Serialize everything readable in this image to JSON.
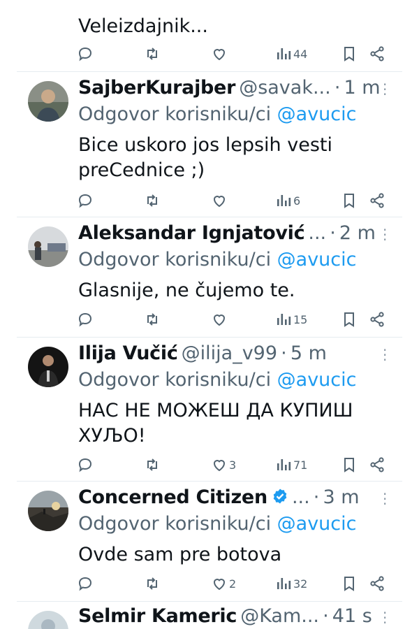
{
  "colors": {
    "accent": "#1d9bf0",
    "secondary_text": "#536471",
    "divider": "#e6ecf0"
  },
  "tweets": [
    {
      "name": "",
      "handle": "",
      "time": "",
      "reply_prefix": "",
      "reply_to": "",
      "text_lines": [
        "Veleizdajnik..."
      ],
      "actions": {
        "replies": "",
        "retweets": "",
        "likes": "",
        "views": "44"
      }
    },
    {
      "name": "SajberKurajber",
      "handle": "@savak...",
      "time": "1 m",
      "reply_prefix": "Odgovor korisniku/ci ",
      "reply_to": "@avucic",
      "text_lines": [
        "Bice uskoro jos lepsih vesti",
        "preCednice ;)"
      ],
      "actions": {
        "replies": "",
        "retweets": "",
        "likes": "",
        "views": "6"
      }
    },
    {
      "name": "Aleksandar Ignjatović",
      "handle": "...",
      "time": "2 m",
      "reply_prefix": "Odgovor korisniku/ci ",
      "reply_to": "@avucic",
      "text_lines": [
        "Glasnije, ne čujemo te."
      ],
      "actions": {
        "replies": "",
        "retweets": "",
        "likes": "",
        "views": "15"
      }
    },
    {
      "name": "Ilija Vučić",
      "handle": "@ilija_v99",
      "time": "5 m",
      "reply_prefix": "Odgovor korisniku/ci ",
      "reply_to": "@avucic",
      "text_lines": [
        "НАС НЕ МОЖЕШ ДА КУПИШ",
        "ХУЉО!"
      ],
      "actions": {
        "replies": "",
        "retweets": "",
        "likes": "3",
        "views": "71"
      }
    },
    {
      "name": "Concerned Citizen",
      "handle": "...",
      "time": "3 m",
      "reply_prefix": "Odgovor korisniku/ci ",
      "reply_to": "@avucic",
      "text_lines": [
        "Ovde sam pre botova"
      ],
      "actions": {
        "replies": "",
        "retweets": "",
        "likes": "2",
        "views": "32"
      }
    },
    {
      "name": "Selmir Kameric",
      "handle": "@Kam...",
      "time": "41 s"
    }
  ]
}
